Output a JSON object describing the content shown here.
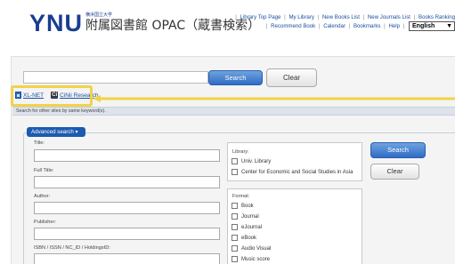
{
  "header": {
    "logo_text": "YNU",
    "logo_small": "横浜国立大学",
    "logo_title": "附属図書館 OPAC（蔵書検索）"
  },
  "top_links": {
    "library_top": "Library Top Page",
    "my_library": "My Library",
    "new_books": "New Books List",
    "new_journals": "New Journals List",
    "books_ranking": "Books Ranking",
    "recommend": "Recommend Book",
    "calendar": "Calendar",
    "bookmarks": "Bookmarks",
    "help": "Help",
    "language": "English"
  },
  "search": {
    "query": "",
    "search_label": "Search",
    "clear_label": "Clear"
  },
  "external": {
    "xlnet": "XL-NET",
    "cinii_icon": "Ci",
    "cinii": "CiNii Research",
    "other_sites": "Search for other sites by same keyword(s)."
  },
  "advanced": {
    "tab_label": "Advanced search",
    "title": "Title:",
    "full_title": "Full Title:",
    "author": "Author:",
    "publisher": "Publisher:",
    "isbn": "ISBN / ISSN / NC_ID / HoldingsID:",
    "library_label": "Library:",
    "libraries": [
      "Univ. Library",
      "Center for Economic and Social Studies in Asia"
    ],
    "format_label": "Format:",
    "formats": [
      "Book",
      "Journal",
      "eJournal",
      "eBook",
      "Audio Visual",
      "Music score"
    ],
    "search_label": "Search",
    "clear_label": "Clear"
  },
  "colors": {
    "highlight": "#f2d24a",
    "accent": "#1d5ab0",
    "logo": "#1a3d8f"
  }
}
